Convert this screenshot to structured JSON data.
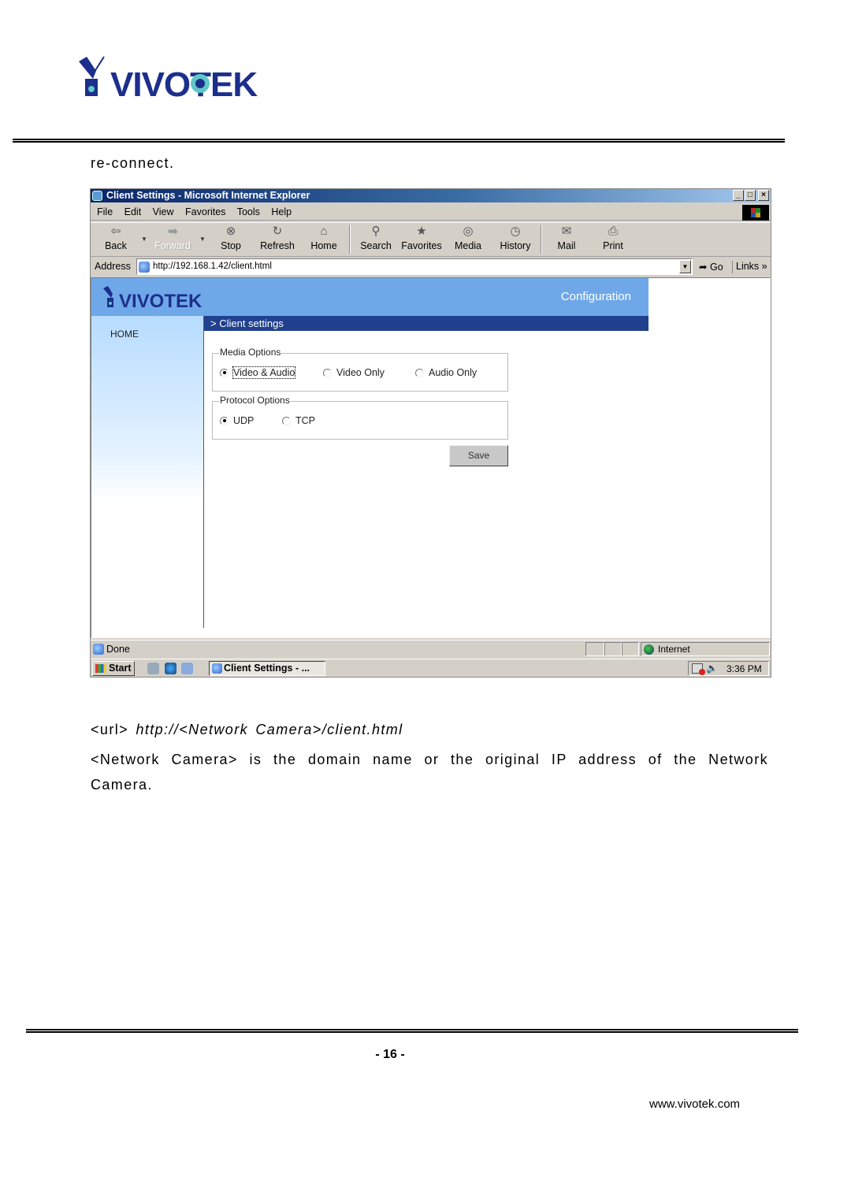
{
  "document": {
    "brand": "VIVOTEK",
    "intro_text": "re-connect.",
    "url_prefix": "<url>",
    "url_value": "http://<Network Camera>/client.html",
    "description": "<Network Camera> is the domain name or the original IP address of the Network Camera.",
    "page_number": "- 16 -",
    "website": "www.vivotek.com"
  },
  "browser": {
    "title": "Client Settings - Microsoft Internet Explorer",
    "window_buttons": [
      "_",
      "□",
      "×"
    ],
    "menu": [
      {
        "label": "File",
        "key": "F"
      },
      {
        "label": "Edit",
        "key": "E"
      },
      {
        "label": "View",
        "key": "V"
      },
      {
        "label": "Favorites",
        "key": "a"
      },
      {
        "label": "Tools",
        "key": "T"
      },
      {
        "label": "Help",
        "key": "H"
      }
    ],
    "toolbar": {
      "back": "Back",
      "forward": "Forward",
      "stop": "Stop",
      "refresh": "Refresh",
      "home": "Home",
      "search": "Search",
      "favorites": "Favorites",
      "media": "Media",
      "history": "History",
      "mail": "Mail",
      "print": "Print"
    },
    "address_label": "Address",
    "address_url": "http://192.168.1.42/client.html",
    "go_label": "Go",
    "links_label": "Links »",
    "status_text": "Done",
    "zone_text": "Internet"
  },
  "webpage": {
    "brand": "VIVOTEK",
    "header_label": "Configuration",
    "sidebar_home": "HOME",
    "section_title": "> Client settings",
    "media_options": {
      "legend": "Media Options",
      "options": [
        "Video & Audio",
        "Video Only",
        "Audio Only"
      ],
      "selected": "Video & Audio"
    },
    "protocol_options": {
      "legend": "Protocol Options",
      "options": [
        "UDP",
        "TCP"
      ],
      "selected": "UDP"
    },
    "save_label": "Save"
  },
  "taskbar": {
    "start_label": "Start",
    "task_label": "Client Settings - ...",
    "clock": "3:36 PM"
  },
  "colors": {
    "brand_navy": "#1c2f8c",
    "page_header": "#6fa8e8",
    "section_bar": "#21418f"
  }
}
